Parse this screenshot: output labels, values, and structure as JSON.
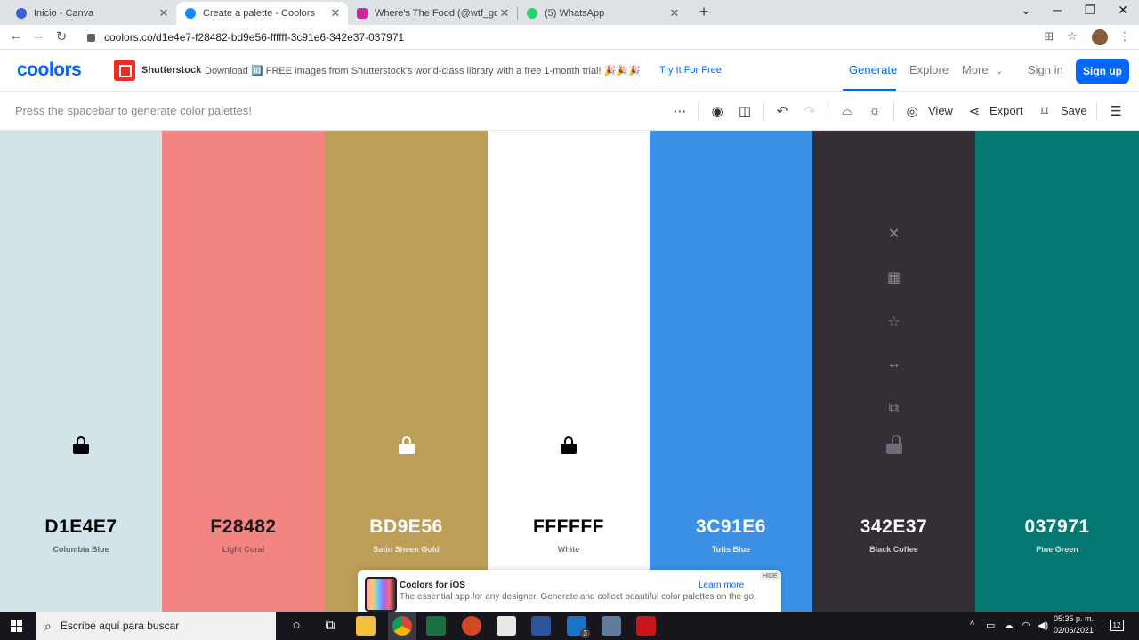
{
  "browser": {
    "tabs": [
      {
        "title": "Inicio - Canva",
        "favicon_color": "#3d5fd6",
        "active": false
      },
      {
        "title": "Create a palette - Coolors",
        "favicon_color": "#0d8dff",
        "active": true
      },
      {
        "title": "Where's The Food (@wtf_gdl) • F",
        "favicon_color": "#d6249f",
        "active": false
      },
      {
        "title": "(5) WhatsApp",
        "favicon_color": "#25d366",
        "active": false
      }
    ],
    "url": "coolors.co/d1e4e7-f28482-bd9e56-ffffff-3c91e6-342e37-037971"
  },
  "header": {
    "logo": "coolors",
    "sponsor_name": "Shutterstock",
    "sponsor_text": "Download 🔟 FREE images from Shutterstock's world-class library with a free 1-month trial! 🎉🎉🎉",
    "sponsor_cta": "Try It For Free",
    "nav": {
      "generate": "Generate",
      "explore": "Explore",
      "more": "More",
      "sign_in": "Sign in",
      "sign_up": "Sign up"
    }
  },
  "subbar": {
    "hint": "Press the spacebar to generate color palettes!",
    "view": "View",
    "export": "Export",
    "save": "Save"
  },
  "palette": {
    "colors": [
      {
        "hex": "D1E4E7",
        "name": "Columbia Blue",
        "bg": "#d1e4e7",
        "fg": "#000000",
        "sub": "#5d6b6d",
        "locked": true
      },
      {
        "hex": "F28482",
        "name": "Light Coral",
        "bg": "#f28482",
        "fg": "#1a1a1a",
        "sub": "#8c4a49",
        "locked": false
      },
      {
        "hex": "BD9E56",
        "name": "Satin Sheen Gold",
        "bg": "#bd9e56",
        "fg": "#ffffff",
        "sub": "#f3ead6",
        "locked": true
      },
      {
        "hex": "FFFFFF",
        "name": "White",
        "bg": "#ffffff",
        "fg": "#000000",
        "sub": "#7a7a7a",
        "locked": true
      },
      {
        "hex": "3C91E6",
        "name": "Tufts Blue",
        "bg": "#3c91e6",
        "fg": "#ffffff",
        "sub": "#e6f0fb",
        "locked": false
      },
      {
        "hex": "342E37",
        "name": "Black Coffee",
        "bg": "#342e37",
        "fg": "#ffffff",
        "sub": "#cfcbd1",
        "locked": false
      },
      {
        "hex": "037971",
        "name": "Pine Green",
        "bg": "#037971",
        "fg": "#ffffff",
        "sub": "#cfe8e6",
        "locked": false
      }
    ]
  },
  "promo": {
    "title": "Coolors for iOS",
    "description": "The essential app for any designer. Generate and collect beautiful color palettes on the go.",
    "learn_more": "Learn more",
    "hide": "HIDE"
  },
  "taskbar": {
    "search_placeholder": "Escribe aquí para buscar",
    "time": "05:35 p. m.",
    "date": "02/06/2021",
    "notifications": "12",
    "mail_badge": "3"
  }
}
